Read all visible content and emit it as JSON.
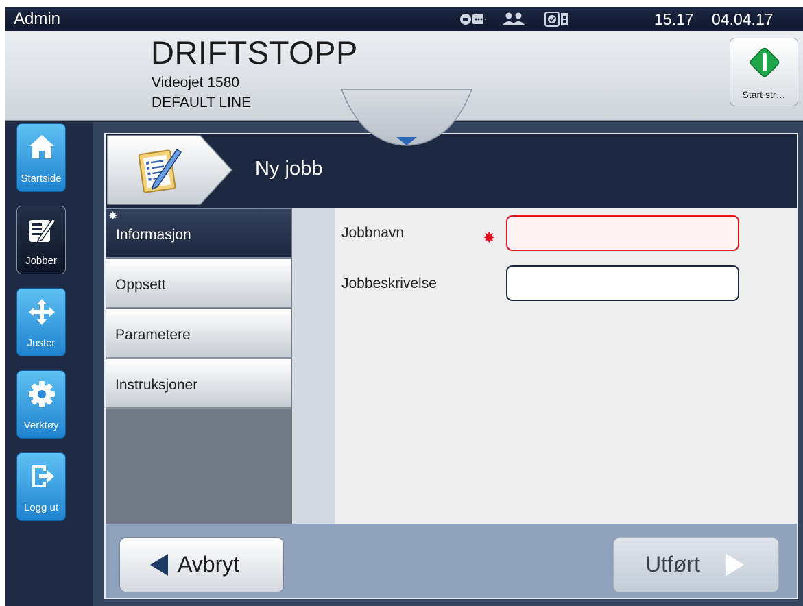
{
  "status_bar": {
    "user": "Admin",
    "time": "15.17",
    "date": "04.04.17",
    "icons": [
      "network-icon",
      "users-icon",
      "checklist-status-icon"
    ]
  },
  "header": {
    "printer_status": "DRIFTSTOPP",
    "printer_model": "Videojet 1580",
    "line_name": "DEFAULT LINE",
    "start_button_label": "Start str…",
    "start_icon": "start-printer-icon"
  },
  "sidebar": {
    "items": [
      {
        "label": "Startside",
        "icon": "home-icon"
      },
      {
        "label": "Jobber",
        "icon": "job-edit-icon"
      },
      {
        "label": "Juster",
        "icon": "move-arrows-icon"
      },
      {
        "label": "Verktøy",
        "icon": "gear-icon"
      },
      {
        "label": "Logg ut",
        "icon": "logout-icon"
      }
    ],
    "active": "Jobber"
  },
  "page": {
    "title": "Ny jobb",
    "icon": "clipboard-edit-icon"
  },
  "tabs": [
    {
      "label": "Informasjon",
      "active": true
    },
    {
      "label": "Oppsett"
    },
    {
      "label": "Parametere"
    },
    {
      "label": "Instruksjoner"
    }
  ],
  "form": {
    "job_name_label": "Jobbnavn",
    "job_name_value": "",
    "required_marker": "✸",
    "job_description_label": "Jobbeskrivelse",
    "job_description_value": ""
  },
  "footer": {
    "cancel_label": "Avbryt",
    "done_label": "Utført"
  },
  "colors": {
    "navy": "#1b2840",
    "accent_blue": "#1f82cf",
    "error_red": "#e0141e",
    "start_green": "#1fa54a"
  }
}
